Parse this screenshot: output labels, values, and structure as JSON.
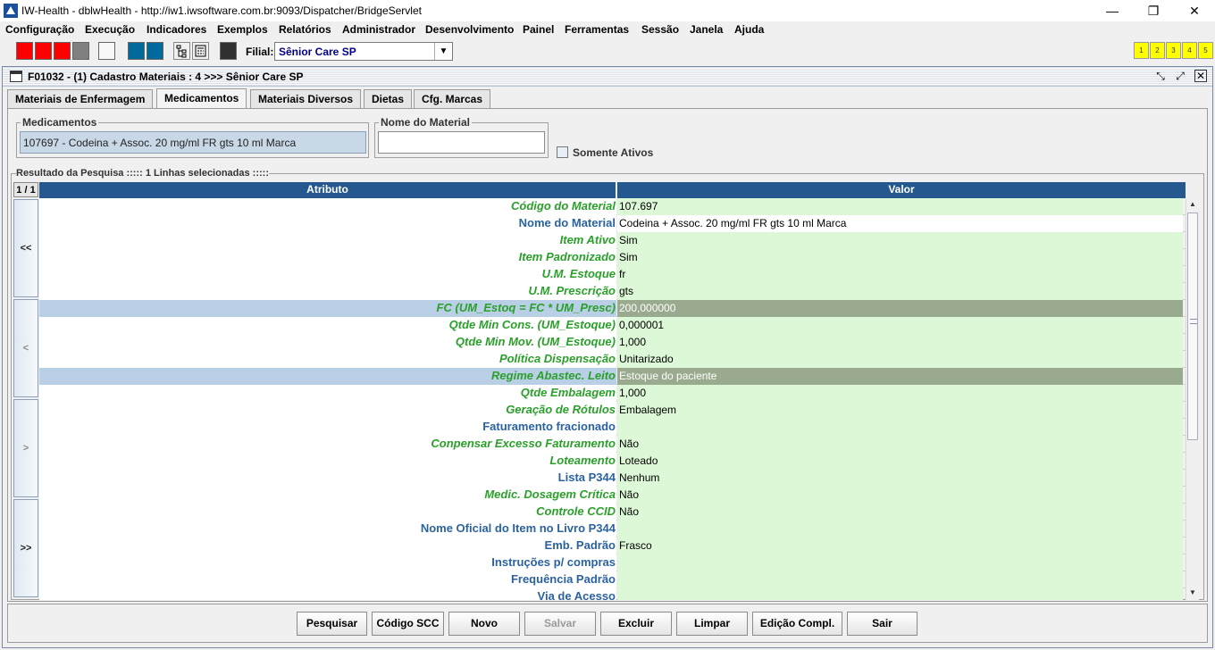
{
  "window": {
    "title": "IW-Health - dblwHealth - http://iw1.iwsoftware.com.br:9093/Dispatcher/BridgeServlet",
    "minimize": "—",
    "restore": "❐",
    "close": "✕"
  },
  "menu": [
    "Configuração",
    "Execução",
    "Indicadores",
    "Exemplos",
    "Relatórios",
    "Administrador",
    "Desenvolvimento",
    "Painel",
    "Ferramentas",
    "Sessão",
    "Janela",
    "Ajuda"
  ],
  "toolbar": {
    "filial_label": "Filial:",
    "filial_value": "Sênior Care SP",
    "quick_buttons": [
      "1",
      "2",
      "3",
      "4",
      "5"
    ],
    "colors": {
      "red": "#ff0000",
      "gray": "#808080",
      "teal": "#006a9c",
      "dark": "#303030"
    }
  },
  "frame": {
    "title": "F01032 - (1) Cadastro Materiais : 4 >>> Sênior Care SP"
  },
  "tabs": [
    {
      "label": "Materiais de Enfermagem",
      "active": false
    },
    {
      "label": "Medicamentos",
      "active": true
    },
    {
      "label": "Materiais Diversos",
      "active": false
    },
    {
      "label": "Dietas",
      "active": false
    },
    {
      "label": "Cfg. Marcas",
      "active": false
    }
  ],
  "filters": {
    "medicamentos_label": "Medicamentos",
    "medicamentos_value": "107697 - Codeina + Assoc.   20 mg/ml  FR  gts 10 ml  Marca",
    "nome_label": "Nome do Material",
    "nome_value": "",
    "somente_ativos_label": "Somente Ativos",
    "somente_ativos_checked": false
  },
  "result": {
    "label": "Resultado da Pesquisa ::::: 1 Linhas selecionadas :::::",
    "pager": "1 / 1",
    "col_attr": "Atributo",
    "col_val": "Valor",
    "nav": [
      "<<",
      "<",
      ">",
      ">>"
    ],
    "rows": [
      {
        "attr": "Código do Material",
        "value": "107.697",
        "style": "green"
      },
      {
        "attr": "Nome do Material",
        "value": "Codeina + Assoc.   20 mg/ml  FR  gts 10 ml  Marca",
        "style": "blue",
        "white": true
      },
      {
        "attr": "Item Ativo",
        "value": "Sim",
        "style": "green"
      },
      {
        "attr": "Item Padronizado",
        "value": "Sim",
        "style": "green"
      },
      {
        "attr": "U.M. Estoque",
        "value": "fr",
        "style": "green"
      },
      {
        "attr": "U.M. Prescrição",
        "value": "gts",
        "style": "green"
      },
      {
        "attr": "FC (UM_Estoq = FC * UM_Presc)",
        "value": "200,000000",
        "style": "green",
        "selected": true
      },
      {
        "attr": "Qtde Min Cons.  (UM_Estoque)",
        "value": "0,000001",
        "style": "green"
      },
      {
        "attr": "Qtde Min Mov. (UM_Estoque)",
        "value": "1,000",
        "style": "green"
      },
      {
        "attr": "Política Dispensação",
        "value": "Unitarizado",
        "style": "green"
      },
      {
        "attr": "Regime Abastec. Leito",
        "value": "Estoque do paciente",
        "style": "green",
        "selected": true
      },
      {
        "attr": "Qtde Embalagem",
        "value": "1,000",
        "style": "green"
      },
      {
        "attr": "Geração de Rótulos",
        "value": "Embalagem",
        "style": "green"
      },
      {
        "attr": "Faturamento fracionado",
        "value": "",
        "style": "blue"
      },
      {
        "attr": "Conpensar Excesso Faturamento",
        "value": "Não",
        "style": "green"
      },
      {
        "attr": "Loteamento",
        "value": "Loteado",
        "style": "green"
      },
      {
        "attr": "Lista P344",
        "value": "Nenhum",
        "style": "blue"
      },
      {
        "attr": "Medic. Dosagem Crítica",
        "value": "Não",
        "style": "green"
      },
      {
        "attr": "Controle CCID",
        "value": "Não",
        "style": "green"
      },
      {
        "attr": "Nome Oficial do Item no Livro P344",
        "value": "",
        "style": "blue"
      },
      {
        "attr": "Emb. Padrão",
        "value": "Frasco",
        "style": "blue"
      },
      {
        "attr": "Instruções p/ compras",
        "value": "",
        "style": "blue"
      },
      {
        "attr": "Frequência Padrão",
        "value": "",
        "style": "blue"
      },
      {
        "attr": "Via de Acesso",
        "value": "",
        "style": "blue"
      }
    ]
  },
  "buttons": [
    {
      "label": "Pesquisar",
      "enabled": true
    },
    {
      "label": "Código SCC",
      "enabled": true
    },
    {
      "label": "Novo",
      "enabled": true
    },
    {
      "label": "Salvar",
      "enabled": false
    },
    {
      "label": "Excluir",
      "enabled": true
    },
    {
      "label": "Limpar",
      "enabled": true
    },
    {
      "label": "Edição Compl.",
      "enabled": true
    },
    {
      "label": "Sair",
      "enabled": true
    }
  ]
}
